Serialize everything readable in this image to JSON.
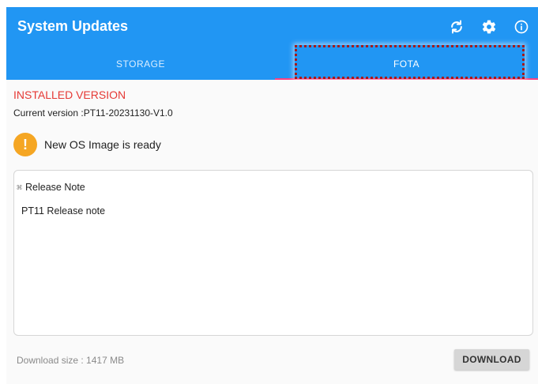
{
  "appbar": {
    "title": "System Updates",
    "actions": [
      {
        "icon": "refresh-icon"
      },
      {
        "icon": "gear-icon"
      },
      {
        "icon": "info-icon"
      }
    ],
    "background": "#2196f3"
  },
  "tabs": [
    {
      "label": "STORAGE",
      "active": false
    },
    {
      "label": "FOTA",
      "active": true
    }
  ],
  "annotation": {
    "highlight_color": "#a31a1a",
    "target": "FOTA"
  },
  "installed": {
    "heading": "INSTALLED VERSION",
    "current_version": "Current version :PT11-20231130-V1.0"
  },
  "alert": {
    "icon": "warning-icon",
    "symbol": "!",
    "message": "New OS Image is ready",
    "color": "#f5a623"
  },
  "release_notes": {
    "heading": "Release Note",
    "body": "PT11 Release note"
  },
  "footer": {
    "download_size": "Download size : 1417 MB",
    "download_label": "DOWNLOAD"
  }
}
